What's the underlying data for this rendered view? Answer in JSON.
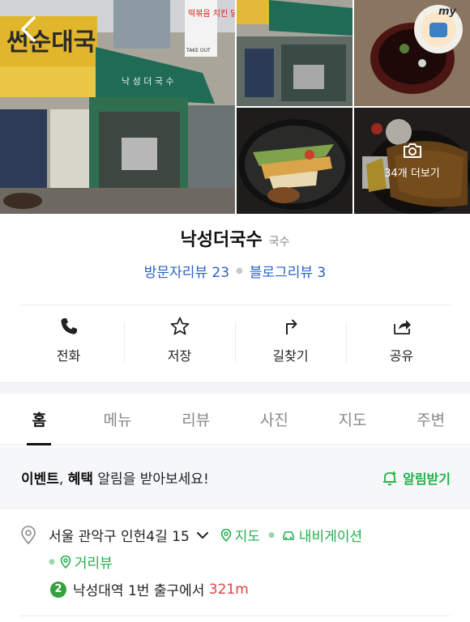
{
  "gallery": {
    "storefront_sign": "썬순대국",
    "awning_text": "낙 성 더 국 수",
    "side_sign": "떡볶음 치킨 닭개",
    "side_sign_takeout": "TAKE OUT",
    "sticker_text": "my",
    "more_label": "34개 더보기"
  },
  "place": {
    "name": "낙성더국수",
    "category": "국수",
    "visitor_reviews": "방문자리뷰 23",
    "blog_reviews": "블로그리뷰 3"
  },
  "actions": [
    {
      "label": "전화",
      "icon": "phone-icon"
    },
    {
      "label": "저장",
      "icon": "star-icon"
    },
    {
      "label": "길찾기",
      "icon": "directions-icon"
    },
    {
      "label": "공유",
      "icon": "share-icon"
    }
  ],
  "tabs": [
    {
      "label": "홈",
      "active": true
    },
    {
      "label": "메뉴",
      "active": false
    },
    {
      "label": "리뷰",
      "active": false
    },
    {
      "label": "사진",
      "active": false
    },
    {
      "label": "지도",
      "active": false
    },
    {
      "label": "주변",
      "active": false
    }
  ],
  "event": {
    "bold1": "이벤트",
    "comma": ", ",
    "bold2": "혜택",
    "rest": " 알림을 받아보세요!",
    "button": "알림받기"
  },
  "address": {
    "text": "서울 관악구 인헌4길 15",
    "map_link": "지도",
    "nav_link": "내비게이션",
    "street_view_link": "거리뷰",
    "subway_line": "2",
    "station": "낙성대역",
    "exit_text": " 1번 출구에서 ",
    "distance": "321m"
  },
  "colors": {
    "accent_green": "#22b04b",
    "link_blue": "#2a61c8",
    "distance_red": "#e0443e",
    "line2_green": "#33a23d"
  }
}
